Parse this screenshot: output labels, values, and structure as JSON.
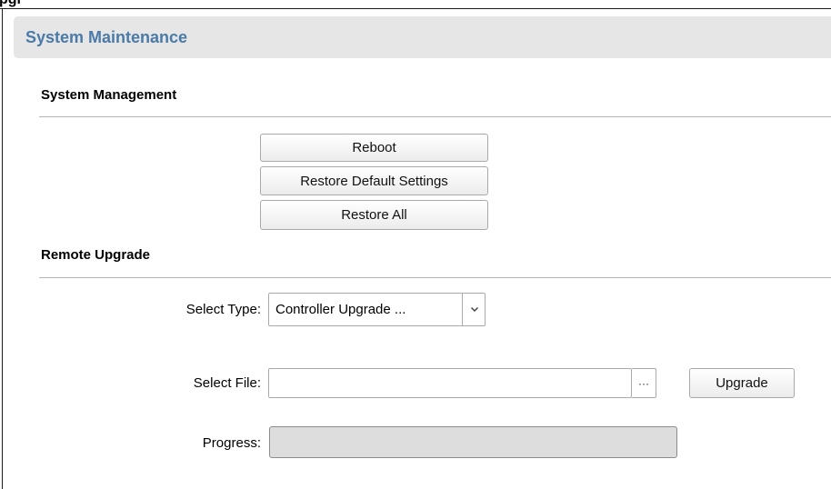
{
  "top_clip_text": "pgr",
  "panel": {
    "title": "System Maintenance"
  },
  "system_management": {
    "title": "System Management",
    "buttons": {
      "reboot": "Reboot",
      "restore_default": "Restore Default Settings",
      "restore_all": "Restore All"
    }
  },
  "remote_upgrade": {
    "title": "Remote Upgrade",
    "select_type": {
      "label": "Select Type:",
      "value": "Controller Upgrade ...",
      "icon": "chevron-down-icon"
    },
    "select_file": {
      "label": "Select File:",
      "value": "",
      "browse_label": "···",
      "icon": "ellipsis-icon"
    },
    "upgrade_label": "Upgrade",
    "progress": {
      "label": "Progress:",
      "fraction": 0
    }
  },
  "colors": {
    "title_blue": "#4a7aa8",
    "header_bg": "#e6e6e6",
    "progress_bg": "#dddddd"
  }
}
